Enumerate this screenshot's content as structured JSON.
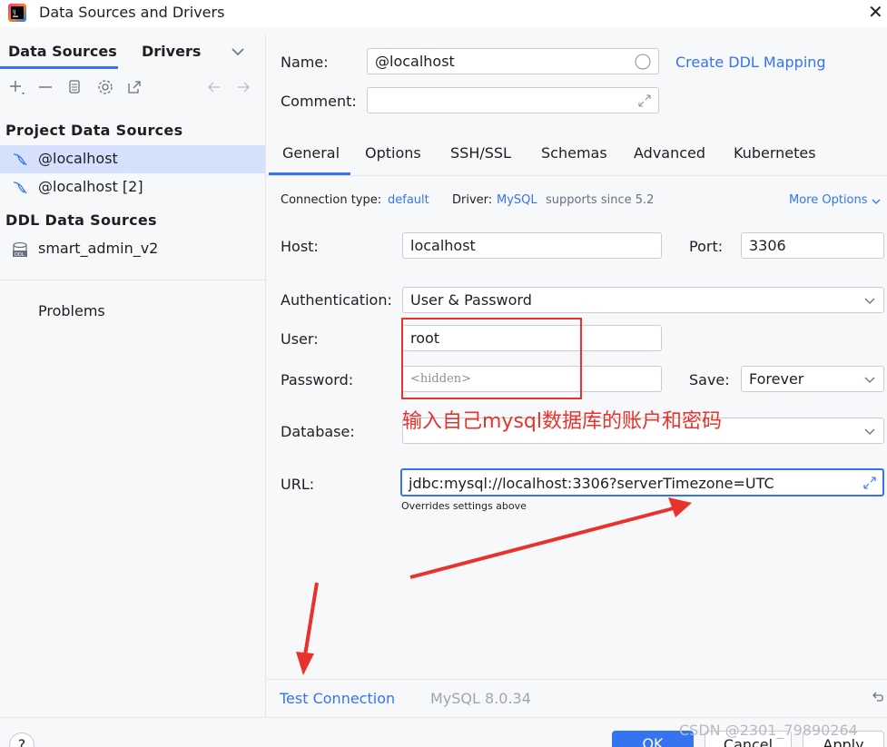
{
  "window": {
    "title": "Data Sources and Drivers",
    "close_glyph": "✕"
  },
  "left": {
    "tabs": [
      {
        "label": "Data Sources"
      },
      {
        "label": "Drivers"
      }
    ],
    "project_header": "Project Data Sources",
    "project_items": [
      {
        "label": "@localhost",
        "selected": true
      },
      {
        "label": "@localhost [2]",
        "selected": false
      }
    ],
    "ddl_header": "DDL Data Sources",
    "ddl_items": [
      {
        "label": "smart_admin_v2"
      }
    ],
    "problems": "Problems"
  },
  "form": {
    "name_label": "Name:",
    "name_value": "@localhost",
    "create_ddl": "Create DDL Mapping",
    "comment_label": "Comment:",
    "comment_value": "",
    "tabs": [
      "General",
      "Options",
      "SSH/SSL",
      "Schemas",
      "Advanced",
      "Kubernetes"
    ],
    "conn_type_label": "Connection type:",
    "conn_type_value": "default",
    "driver_label": "Driver:",
    "driver_value": "MySQL",
    "driver_note": "supports since 5.2",
    "more_options": "More Options",
    "host_label": "Host:",
    "host_value": "localhost",
    "port_label": "Port:",
    "port_value": "3306",
    "auth_label": "Authentication:",
    "auth_value": "User & Password",
    "user_label": "User:",
    "user_value": "root",
    "password_label": "Password:",
    "password_value": "<hidden>",
    "save_label": "Save:",
    "save_value": "Forever",
    "database_label": "Database:",
    "database_value": "",
    "url_label": "URL:",
    "url_value": "jdbc:mysql://localhost:3306?serverTimezone=UTC",
    "url_note": "Overrides settings above"
  },
  "annotation": {
    "text": "输入自己mysql数据库的账户和密码",
    "color": "#e8322c"
  },
  "bottom": {
    "test_connection": "Test Connection",
    "mysql_version": "MySQL 8.0.34"
  },
  "footer": {
    "help": "?",
    "ok": "OK",
    "cancel": "Cancel",
    "apply": "Apply",
    "watermark": "CSDN @2301_79890264"
  },
  "colors": {
    "accent": "#3574f0",
    "selection": "#d5e1fc",
    "annotation": "#e8322c"
  }
}
